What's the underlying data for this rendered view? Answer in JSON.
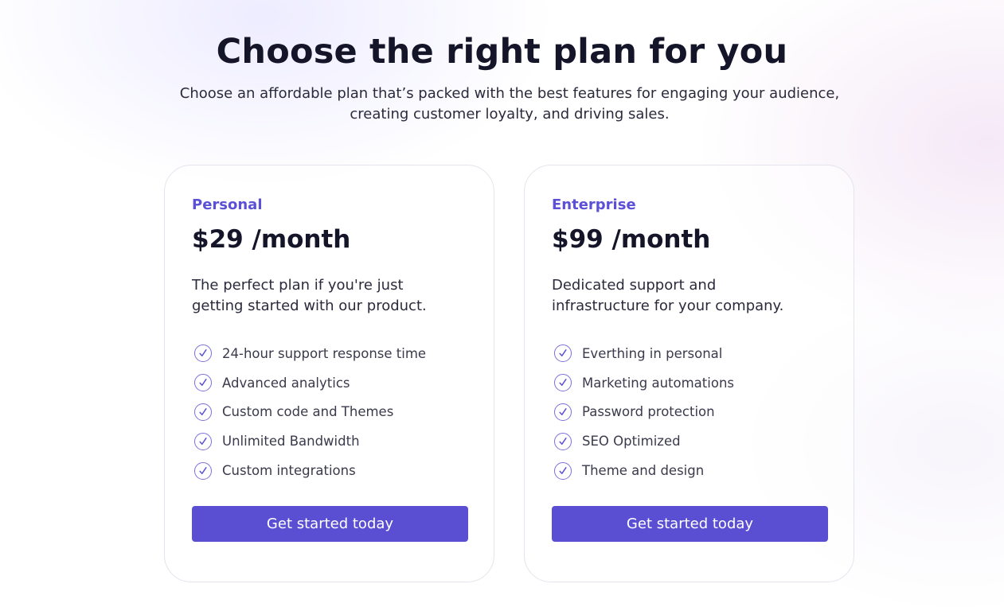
{
  "header": {
    "title": "Choose the right plan for you",
    "subtitle": "Choose an affordable plan that’s packed with the best features for engaging your audience, creating customer loyalty, and driving sales."
  },
  "plans": [
    {
      "name": "Personal",
      "price": "$29 /month",
      "description": "The perfect plan if you're just getting started with our product.",
      "features": [
        "24-hour support response time",
        "Advanced analytics",
        "Custom code and Themes",
        "Unlimited Bandwidth",
        "Custom integrations"
      ],
      "cta": "Get started today"
    },
    {
      "name": "Enterprise",
      "price": "$99 /month",
      "description": "Dedicated support and infrastructure for your company.",
      "features": [
        "Everthing in personal",
        "Marketing automations",
        "Password protection",
        "SEO Optimized",
        "Theme and design"
      ],
      "cta": "Get started today"
    }
  ],
  "icons": {
    "feature": "check-circle-icon"
  },
  "colors": {
    "accent": "#5a4fd3",
    "plan_name": "#5b50d6",
    "check": "#7a70dd",
    "heading": "#15152a"
  }
}
